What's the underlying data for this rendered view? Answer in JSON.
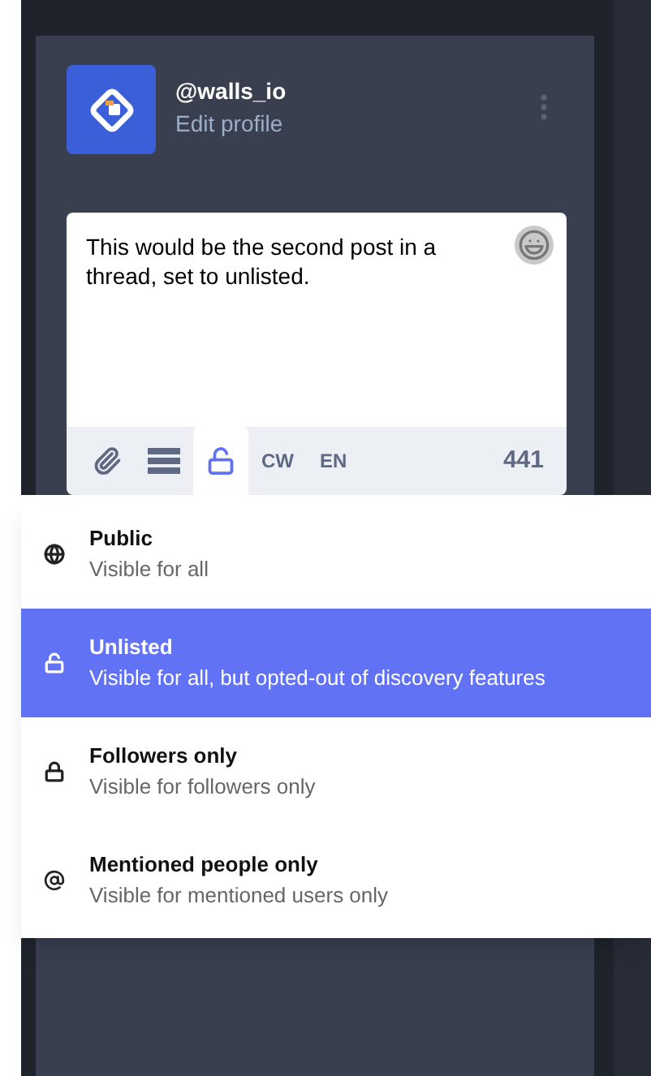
{
  "profile": {
    "handle": "@walls_io",
    "link": "Edit profile"
  },
  "composer": {
    "value": "This would be the second post in a thread, set to unlisted.",
    "toolbar": [
      {
        "kind": "attach",
        "selected": false
      },
      {
        "kind": "poll",
        "selected": false
      },
      {
        "kind": "privacy",
        "selected": true
      },
      {
        "kind": "text",
        "label": "CW",
        "selected": false
      },
      {
        "kind": "text",
        "label": "EN",
        "selected": false
      }
    ],
    "counter": "441"
  },
  "privacy_menu": [
    {
      "kind": "public",
      "title": "Public",
      "description": "Visible for all",
      "selected": false
    },
    {
      "kind": "unlisted",
      "title": "Unlisted",
      "description": "Visible for all, but opted-out of discovery features",
      "selected": true
    },
    {
      "kind": "private",
      "title": "Followers only",
      "description": "Visible for followers only",
      "selected": false
    },
    {
      "kind": "direct",
      "title": "Mentioned people only",
      "description": "Visible for mentioned users only",
      "selected": false
    }
  ]
}
